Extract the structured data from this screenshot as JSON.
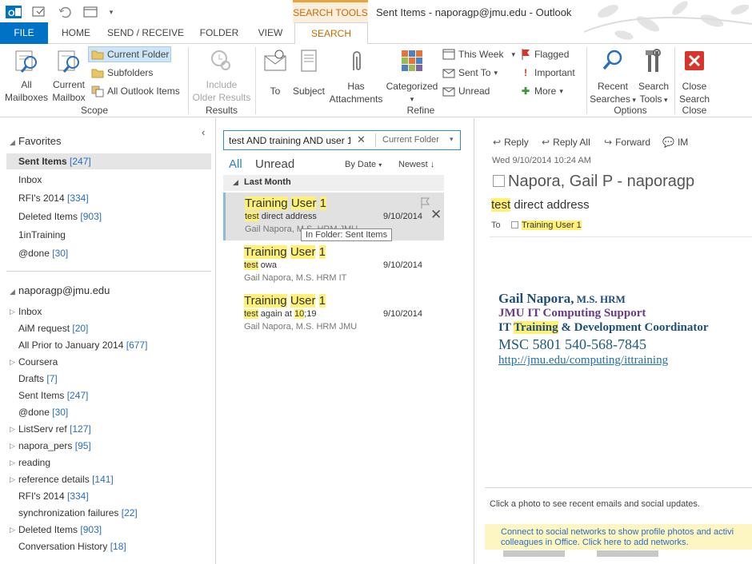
{
  "window": {
    "title": "Sent Items - naporagp@jmu.edu - Outlook",
    "context_tab": "SEARCH TOOLS"
  },
  "tabs": [
    {
      "label": "FILE"
    },
    {
      "label": "HOME"
    },
    {
      "label": "SEND / RECEIVE"
    },
    {
      "label": "FOLDER"
    },
    {
      "label": "VIEW"
    },
    {
      "label": "SEARCH"
    }
  ],
  "ribbon": {
    "scope": {
      "group": "Scope",
      "all_mailboxes": [
        "All",
        "Mailboxes"
      ],
      "current_mailbox": [
        "Current",
        "Mailbox"
      ],
      "current_folder": "Current Folder",
      "subfolders": "Subfolders",
      "all_outlook_items": "All Outlook Items"
    },
    "results": {
      "group": "Results",
      "include_older": [
        "Include",
        "Older Results"
      ]
    },
    "refine": {
      "group": "Refine",
      "to": "To",
      "subject": "Subject",
      "has_attachments": [
        "Has",
        "Attachments"
      ],
      "categorized": "Categorized",
      "this_week": "This Week",
      "sent_to": "Sent To",
      "unread": "Unread",
      "flagged": "Flagged",
      "important": "Important",
      "more": "More"
    },
    "options": {
      "group": "Options",
      "recent_searches": [
        "Recent",
        "Searches"
      ],
      "search_tools": [
        "Search",
        "Tools"
      ]
    },
    "close": {
      "group": "Close",
      "close_search": [
        "Close",
        "Search"
      ]
    }
  },
  "folders": {
    "favorites_header": "Favorites",
    "favorites": [
      {
        "name": "Sent Items",
        "count": "[247]"
      },
      {
        "name": "Inbox",
        "count": ""
      },
      {
        "name": "RFI's 2014",
        "count": "[334]"
      },
      {
        "name": "Deleted Items",
        "count": "[903]"
      },
      {
        "name": "1inTraining",
        "count": ""
      },
      {
        "name": "@done",
        "count": "[30]"
      }
    ],
    "account_header": "naporagp@jmu.edu",
    "account": [
      {
        "name": "Inbox",
        "count": ""
      },
      {
        "name": "AiM request",
        "count": "[20]"
      },
      {
        "name": "All Prior to January 2014",
        "count": "[677]"
      },
      {
        "name": "Coursera",
        "count": ""
      },
      {
        "name": "Drafts",
        "count": "[7]"
      },
      {
        "name": "Sent Items",
        "count": "[247]"
      },
      {
        "name": "@done",
        "count": "[30]"
      },
      {
        "name": "ListServ ref",
        "count": "[127]"
      },
      {
        "name": "napora_pers",
        "count": "[95]"
      },
      {
        "name": "reading",
        "count": ""
      },
      {
        "name": "reference details",
        "count": "[141]"
      },
      {
        "name": "RFI's 2014",
        "count": "[334]"
      },
      {
        "name": "synchronization failures",
        "count": "[22]"
      },
      {
        "name": "Deleted Items",
        "count": "[903]"
      },
      {
        "name": "Conversation History",
        "count": "[18]"
      }
    ]
  },
  "search": {
    "query": "test AND training AND user 1",
    "scope": "Current Folder"
  },
  "list": {
    "filter_all": "All",
    "filter_unread": "Unread",
    "sort_by": "By Date",
    "order": "Newest",
    "group": "Last Month",
    "tooltip": "In Folder: Sent Items",
    "messages": [
      {
        "w1": "Training",
        "w2": "User",
        "w3": "1",
        "s1": "test",
        "s2": " direct address",
        "date": "9/10/2014",
        "from": "Gail Napora, M.S. HRM  JMU"
      },
      {
        "w1": "Training",
        "w2": "User",
        "w3": "1",
        "s1": "test",
        "s2": " owa",
        "date": "9/10/2014",
        "from": "Gail Napora, M.S. HRM  IT"
      },
      {
        "w1": "Training",
        "w2": "User",
        "w3": "1",
        "s1": "test",
        "s2": " again at ",
        "s3": "10",
        "s4": ";19",
        "date": "9/10/2014",
        "from": "Gail Napora, M.S. HRM  JMU"
      }
    ]
  },
  "reading": {
    "reply": "Reply",
    "reply_all": "Reply All",
    "forward": "Forward",
    "im": "IM",
    "datetime": "Wed 9/10/2014 10:24 AM",
    "sender": "Napora, Gail P - naporagp",
    "subject_hl": "test",
    "subject_rest": " direct address",
    "to_label": "To",
    "to_value": "Training User 1",
    "sig_name": "Gail Napora,",
    "sig_cred": " M.S. HRM",
    "sig_line2": "JMU IT Computing Support",
    "sig_line3a": "IT ",
    "sig_line3b": "Training",
    "sig_line3c": " & Development Coordinator",
    "sig_line4": "MSC 5801  540-568-7845",
    "sig_link": "http://jmu.edu/computing/ittraining",
    "people_note": "Click a photo to see recent emails and social updates.",
    "social_note1": "Connect to social networks to show profile photos and activi",
    "social_note2": "colleagues in Office. Click here to add networks."
  },
  "colors": {
    "accent": "#0072c6",
    "search_orange": "#c76a00",
    "highlight": "#fff176"
  }
}
